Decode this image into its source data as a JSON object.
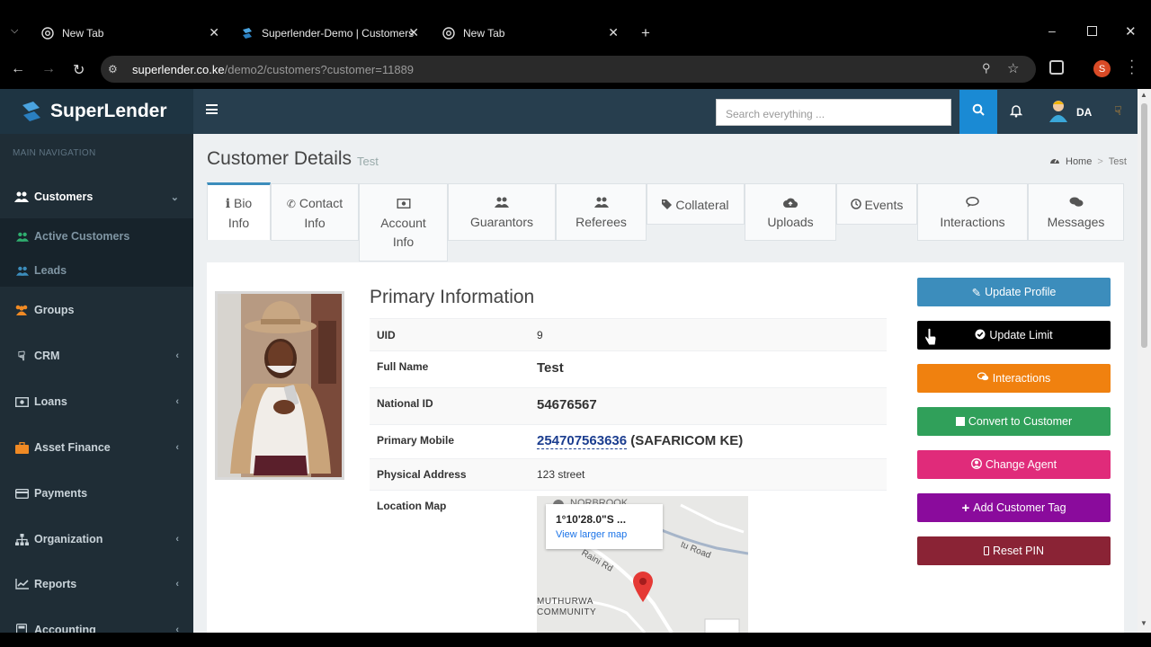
{
  "browser": {
    "tabs": [
      {
        "title": "New Tab",
        "icon": "chrome-icon"
      },
      {
        "title": "Superlender-Demo | Customers",
        "icon": "superlender-logo-icon"
      },
      {
        "title": "New Tab",
        "icon": "chrome-icon"
      }
    ],
    "url_host": "superlender.co.ke",
    "url_path": "/demo2/customers?customer=11889",
    "profile_initial": "S"
  },
  "app": {
    "brand": "SuperLender",
    "search_placeholder": "Search everything ...",
    "user_initials": "DA"
  },
  "sidebar": {
    "heading": "MAIN NAVIGATION",
    "items": [
      {
        "label": "Customers",
        "icon": "users-icon"
      },
      {
        "label": "Groups",
        "icon": "group-icon"
      },
      {
        "label": "CRM",
        "icon": "hand-pointer-icon"
      },
      {
        "label": "Loans",
        "icon": "money-icon"
      },
      {
        "label": "Asset Finance",
        "icon": "briefcase-icon"
      },
      {
        "label": "Payments",
        "icon": "credit-card-icon"
      },
      {
        "label": "Organization",
        "icon": "sitemap-icon"
      },
      {
        "label": "Reports",
        "icon": "line-chart-icon"
      },
      {
        "label": "Accounting",
        "icon": "calculator-icon"
      }
    ],
    "sub_items": [
      {
        "label": "Active Customers"
      },
      {
        "label": "Leads"
      }
    ]
  },
  "page": {
    "title": "Customer Details",
    "subtitle": "Test",
    "breadcrumb_home": "Home",
    "breadcrumb_current": "Test"
  },
  "detail_tabs": [
    {
      "line1": "Bio",
      "line2": "Info",
      "icon": "info-icon"
    },
    {
      "line1": "Contact",
      "line2": "Info",
      "icon": "phone-icon"
    },
    {
      "line1": "Account",
      "line2": "Info",
      "icon": "money-icon"
    },
    {
      "line1": "Guarantors",
      "icon": "users-icon"
    },
    {
      "line1": "Referees",
      "icon": "users-icon"
    },
    {
      "line1": "Collateral",
      "icon": "tag-icon"
    },
    {
      "line1": "Uploads",
      "icon": "cloud-upload-icon"
    },
    {
      "line1": "Events",
      "icon": "clock-icon"
    },
    {
      "line1": "Interactions",
      "icon": "comment-icon"
    },
    {
      "line1": "Messages",
      "icon": "comments-icon"
    }
  ],
  "primary": {
    "title": "Primary Information",
    "rows": [
      {
        "label": "UID",
        "value": "9"
      },
      {
        "label": "Full Name",
        "value": "Test"
      },
      {
        "label": "National ID",
        "value": "54676567"
      },
      {
        "label": "Primary Mobile",
        "phone": "254707563636",
        "carrier": " (SAFARICOM KE)"
      },
      {
        "label": "Physical Address",
        "value": "123 street"
      },
      {
        "label": "Location Map"
      }
    ]
  },
  "map": {
    "coords": "1°10'28.0\"S ...",
    "link": "View larger map",
    "label_top": "NORBROOK",
    "road1": "Ruthimitu Road",
    "road2": "Raini Rd",
    "community_line1": "MUTHURWA",
    "community_line2": "COMMUNITY"
  },
  "actions": [
    {
      "label": "Update Profile",
      "icon": "pencil-icon",
      "color": "#3c8dbc"
    },
    {
      "label": "Update Limit",
      "icon": "check-circle-icon",
      "color": "#000000"
    },
    {
      "label": "Interactions",
      "icon": "comments-icon",
      "color": "#f0810f"
    },
    {
      "label": "Convert to Customer",
      "icon": "square-icon",
      "color": "#30a05a"
    },
    {
      "label": "Change Agent",
      "icon": "user-circle-icon",
      "color": "#e02b7a"
    },
    {
      "label": "Add Customer Tag",
      "icon": "plus-icon",
      "color": "#8a0b9c"
    },
    {
      "label": "Reset PIN",
      "icon": "mobile-icon",
      "color": "#8a2335"
    }
  ]
}
